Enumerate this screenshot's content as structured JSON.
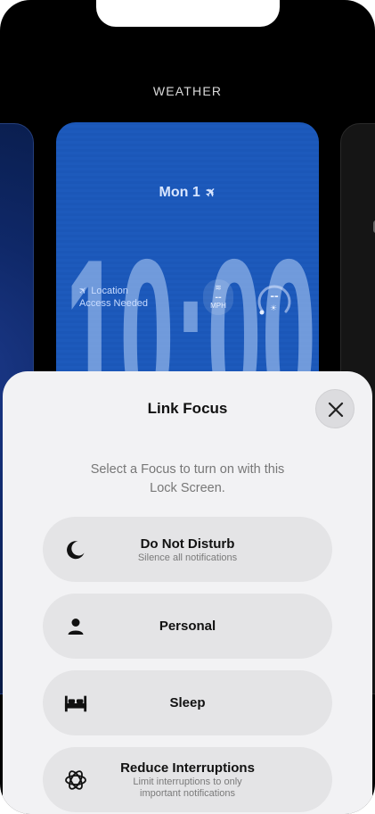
{
  "gallery": {
    "title": "WEATHER"
  },
  "lock_screen": {
    "date": "Mon 1",
    "time": "10:00",
    "location_widget": {
      "line1": "Location",
      "line2": "Access Needed"
    },
    "wind_widget": {
      "value": "--",
      "unit": "MPH"
    },
    "uv_widget": {
      "value": "--"
    },
    "background_color": "#1b57b8"
  },
  "sheet": {
    "title": "Link Focus",
    "subtitle_line1": "Select a Focus to turn on with this",
    "subtitle_line2": "Lock Screen.",
    "options": [
      {
        "icon": "moon-icon",
        "label": "Do Not Disturb",
        "sub": "Silence all notifications"
      },
      {
        "icon": "person-icon",
        "label": "Personal",
        "sub": ""
      },
      {
        "icon": "bed-icon",
        "label": "Sleep",
        "sub": ""
      },
      {
        "icon": "reduce-interruptions-icon",
        "label": "Reduce Interruptions",
        "sub_line1": "Limit interruptions to only",
        "sub_line2": "important notifications"
      }
    ]
  }
}
